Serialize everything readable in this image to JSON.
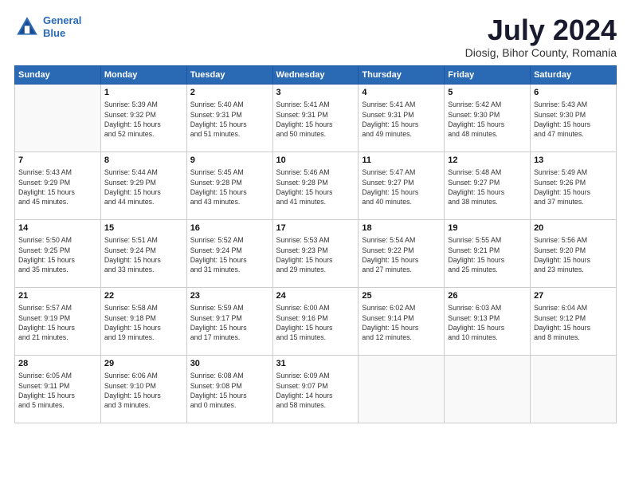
{
  "header": {
    "logo_line1": "General",
    "logo_line2": "Blue",
    "title": "July 2024",
    "subtitle": "Diosig, Bihor County, Romania"
  },
  "weekdays": [
    "Sunday",
    "Monday",
    "Tuesday",
    "Wednesday",
    "Thursday",
    "Friday",
    "Saturday"
  ],
  "weeks": [
    [
      {
        "day": "",
        "info": ""
      },
      {
        "day": "1",
        "info": "Sunrise: 5:39 AM\nSunset: 9:32 PM\nDaylight: 15 hours\nand 52 minutes."
      },
      {
        "day": "2",
        "info": "Sunrise: 5:40 AM\nSunset: 9:31 PM\nDaylight: 15 hours\nand 51 minutes."
      },
      {
        "day": "3",
        "info": "Sunrise: 5:41 AM\nSunset: 9:31 PM\nDaylight: 15 hours\nand 50 minutes."
      },
      {
        "day": "4",
        "info": "Sunrise: 5:41 AM\nSunset: 9:31 PM\nDaylight: 15 hours\nand 49 minutes."
      },
      {
        "day": "5",
        "info": "Sunrise: 5:42 AM\nSunset: 9:30 PM\nDaylight: 15 hours\nand 48 minutes."
      },
      {
        "day": "6",
        "info": "Sunrise: 5:43 AM\nSunset: 9:30 PM\nDaylight: 15 hours\nand 47 minutes."
      }
    ],
    [
      {
        "day": "7",
        "info": "Sunrise: 5:43 AM\nSunset: 9:29 PM\nDaylight: 15 hours\nand 45 minutes."
      },
      {
        "day": "8",
        "info": "Sunrise: 5:44 AM\nSunset: 9:29 PM\nDaylight: 15 hours\nand 44 minutes."
      },
      {
        "day": "9",
        "info": "Sunrise: 5:45 AM\nSunset: 9:28 PM\nDaylight: 15 hours\nand 43 minutes."
      },
      {
        "day": "10",
        "info": "Sunrise: 5:46 AM\nSunset: 9:28 PM\nDaylight: 15 hours\nand 41 minutes."
      },
      {
        "day": "11",
        "info": "Sunrise: 5:47 AM\nSunset: 9:27 PM\nDaylight: 15 hours\nand 40 minutes."
      },
      {
        "day": "12",
        "info": "Sunrise: 5:48 AM\nSunset: 9:27 PM\nDaylight: 15 hours\nand 38 minutes."
      },
      {
        "day": "13",
        "info": "Sunrise: 5:49 AM\nSunset: 9:26 PM\nDaylight: 15 hours\nand 37 minutes."
      }
    ],
    [
      {
        "day": "14",
        "info": "Sunrise: 5:50 AM\nSunset: 9:25 PM\nDaylight: 15 hours\nand 35 minutes."
      },
      {
        "day": "15",
        "info": "Sunrise: 5:51 AM\nSunset: 9:24 PM\nDaylight: 15 hours\nand 33 minutes."
      },
      {
        "day": "16",
        "info": "Sunrise: 5:52 AM\nSunset: 9:24 PM\nDaylight: 15 hours\nand 31 minutes."
      },
      {
        "day": "17",
        "info": "Sunrise: 5:53 AM\nSunset: 9:23 PM\nDaylight: 15 hours\nand 29 minutes."
      },
      {
        "day": "18",
        "info": "Sunrise: 5:54 AM\nSunset: 9:22 PM\nDaylight: 15 hours\nand 27 minutes."
      },
      {
        "day": "19",
        "info": "Sunrise: 5:55 AM\nSunset: 9:21 PM\nDaylight: 15 hours\nand 25 minutes."
      },
      {
        "day": "20",
        "info": "Sunrise: 5:56 AM\nSunset: 9:20 PM\nDaylight: 15 hours\nand 23 minutes."
      }
    ],
    [
      {
        "day": "21",
        "info": "Sunrise: 5:57 AM\nSunset: 9:19 PM\nDaylight: 15 hours\nand 21 minutes."
      },
      {
        "day": "22",
        "info": "Sunrise: 5:58 AM\nSunset: 9:18 PM\nDaylight: 15 hours\nand 19 minutes."
      },
      {
        "day": "23",
        "info": "Sunrise: 5:59 AM\nSunset: 9:17 PM\nDaylight: 15 hours\nand 17 minutes."
      },
      {
        "day": "24",
        "info": "Sunrise: 6:00 AM\nSunset: 9:16 PM\nDaylight: 15 hours\nand 15 minutes."
      },
      {
        "day": "25",
        "info": "Sunrise: 6:02 AM\nSunset: 9:14 PM\nDaylight: 15 hours\nand 12 minutes."
      },
      {
        "day": "26",
        "info": "Sunrise: 6:03 AM\nSunset: 9:13 PM\nDaylight: 15 hours\nand 10 minutes."
      },
      {
        "day": "27",
        "info": "Sunrise: 6:04 AM\nSunset: 9:12 PM\nDaylight: 15 hours\nand 8 minutes."
      }
    ],
    [
      {
        "day": "28",
        "info": "Sunrise: 6:05 AM\nSunset: 9:11 PM\nDaylight: 15 hours\nand 5 minutes."
      },
      {
        "day": "29",
        "info": "Sunrise: 6:06 AM\nSunset: 9:10 PM\nDaylight: 15 hours\nand 3 minutes."
      },
      {
        "day": "30",
        "info": "Sunrise: 6:08 AM\nSunset: 9:08 PM\nDaylight: 15 hours\nand 0 minutes."
      },
      {
        "day": "31",
        "info": "Sunrise: 6:09 AM\nSunset: 9:07 PM\nDaylight: 14 hours\nand 58 minutes."
      },
      {
        "day": "",
        "info": ""
      },
      {
        "day": "",
        "info": ""
      },
      {
        "day": "",
        "info": ""
      }
    ]
  ]
}
